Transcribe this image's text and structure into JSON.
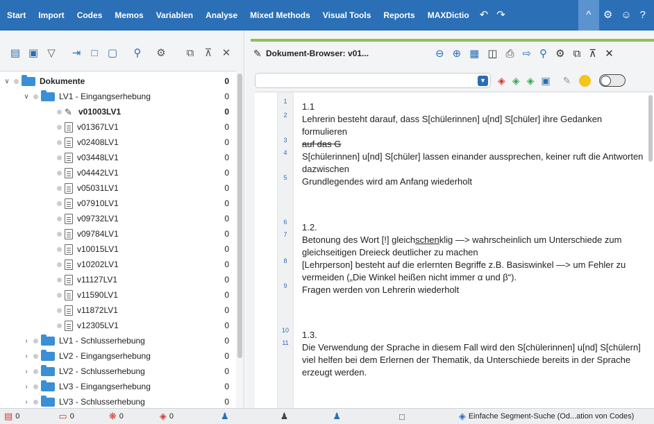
{
  "menubar": {
    "items": [
      "Start",
      "Import",
      "Codes",
      "Memos",
      "Variablen",
      "Analyse",
      "Mixed Methods",
      "Visual Tools",
      "Reports",
      "MAXDictio"
    ],
    "undo_icon": "↶",
    "redo_icon": "↷",
    "collapse_icon": "^",
    "settings_icon": "⚙",
    "smiley_icon": "☺",
    "help_icon": "?"
  },
  "left_toolbar": {
    "icons": [
      "activate-docs-icon",
      "group-icon",
      "filter-icon",
      "import-icon",
      "new-doc-icon",
      "new-group-icon",
      "search-icon",
      "settings-icon",
      "undock-icon",
      "minimize-icon",
      "close-icon"
    ]
  },
  "tree": {
    "root": {
      "label": "Dokumente",
      "count": "0"
    },
    "groups_expanded": {
      "label": "LV1 - Eingangserhebung",
      "count": "0"
    },
    "documents": [
      {
        "label": "v01003LV1",
        "count": "0",
        "bold": true
      },
      {
        "label": "v01367LV1",
        "count": "0"
      },
      {
        "label": "v02408LV1",
        "count": "0"
      },
      {
        "label": "v03448LV1",
        "count": "0"
      },
      {
        "label": "v04442LV1",
        "count": "0"
      },
      {
        "label": "v05031LV1",
        "count": "0"
      },
      {
        "label": "v07910LV1",
        "count": "0"
      },
      {
        "label": "v09732LV1",
        "count": "0"
      },
      {
        "label": "v09784LV1",
        "count": "0"
      },
      {
        "label": "v10015LV1",
        "count": "0"
      },
      {
        "label": "v10202LV1",
        "count": "0"
      },
      {
        "label": "v11127LV1",
        "count": "0"
      },
      {
        "label": "v11590LV1",
        "count": "0"
      },
      {
        "label": "v11872LV1",
        "count": "0"
      },
      {
        "label": "v12305LV1",
        "count": "0"
      }
    ],
    "groups_collapsed": [
      {
        "label": "LV1 - Schlusserhebung",
        "count": "0"
      },
      {
        "label": "LV2 - Eingangserhebung",
        "count": "0"
      },
      {
        "label": "LV2 - Schlusserhebung",
        "count": "0"
      },
      {
        "label": "LV3 - Eingangserhebung",
        "count": "0"
      },
      {
        "label": "LV3 - Schlusserhebung",
        "count": "0"
      }
    ]
  },
  "doc_browser": {
    "title": "Dokument-Browser: v01...",
    "paragraphs": [
      {
        "num": "1",
        "text": "1.1"
      },
      {
        "num": "2",
        "text": "Lehrerin besteht darauf, dass S[chülerinnen] u[nd] S[chüler] ihre Gedanken formulieren"
      },
      {
        "num": "3",
        "text": "auf das G",
        "strike": true
      },
      {
        "num": "4",
        "text": "S[chülerinnen] u[nd] S[chüler] lassen einander aussprechen, keiner ruft die Antworten dazwischen"
      },
      {
        "num": "5",
        "text": "Grundlegendes wird am Anfang wiederholt"
      },
      {
        "num": "6",
        "text": "1.2."
      },
      {
        "num": "7",
        "text_before": "Betonung des Wort [!] gleich",
        "text_under": "schen",
        "text_after": "klig —> wahrscheinlich um Unterschiede zum gleichseitigen Dreieck deutlicher zu machen"
      },
      {
        "num": "8",
        "text": "[Lehrperson] besteht auf die erlernten Begriffe z.B. Basiswinkel —> um Fehler zu vermeiden („Die Winkel heißen nicht immer α und β“)."
      },
      {
        "num": "9",
        "text": "Fragen werden von Lehrerin wiederholt"
      },
      {
        "num": "10",
        "text": "1.3."
      },
      {
        "num": "11",
        "text": "Die Verwendung der Sprache in diesem Fall wird den S[chülerinnen] u[nd] S[chülern] viel helfen bei dem Erlernen der Thematik, da Unterschiede bereits in der Sprache erzeugt werden."
      }
    ]
  },
  "statusbar": {
    "docs_count": "0",
    "memos_count": "0",
    "codes_count": "0",
    "segments_count": "0",
    "search_mode": "Einfache Segment-Suche (Od...ation von Codes)"
  },
  "colors": {
    "menubar": "#2b6fb6",
    "accent_green": "#8cc152",
    "folder_blue": "#3a8fd6",
    "red_icon": "#d0392b"
  }
}
